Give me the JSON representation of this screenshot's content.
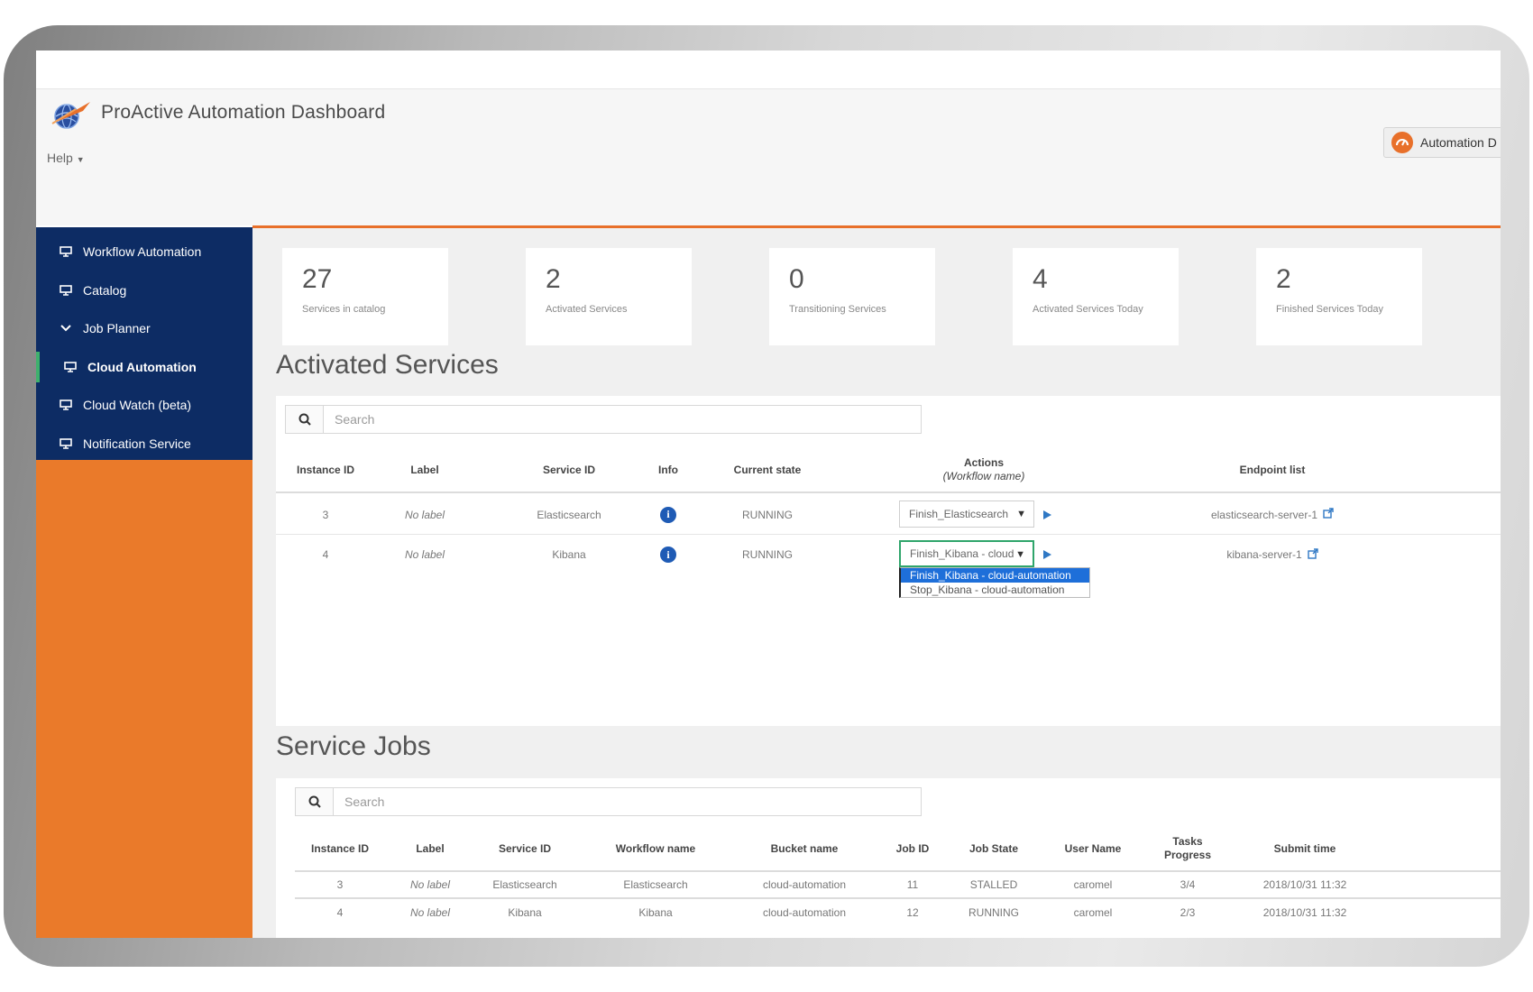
{
  "header": {
    "title": "ProActive Automation Dashboard",
    "help_label": "Help",
    "portal_button_label": "Automation D"
  },
  "sidebar": {
    "items": [
      {
        "label": "Workflow Automation",
        "icon": "monitor-icon"
      },
      {
        "label": "Catalog",
        "icon": "monitor-icon"
      },
      {
        "label": "Job Planner",
        "icon": "chevron-down-icon"
      },
      {
        "label": "Cloud Automation",
        "icon": "monitor-icon",
        "active": true
      },
      {
        "label": "Cloud Watch (beta)",
        "icon": "monitor-icon"
      },
      {
        "label": "Notification Service",
        "icon": "monitor-icon"
      }
    ]
  },
  "stats": [
    {
      "value": "27",
      "label": "Services in catalog"
    },
    {
      "value": "2",
      "label": "Activated Services"
    },
    {
      "value": "0",
      "label": "Transitioning Services"
    },
    {
      "value": "4",
      "label": "Activated Services Today"
    },
    {
      "value": "2",
      "label": "Finished Services Today"
    }
  ],
  "activated_services": {
    "title": "Activated Services",
    "search_placeholder": "Search",
    "columns": {
      "instance_id": "Instance ID",
      "label": "Label",
      "service_id": "Service ID",
      "info": "Info",
      "current_state": "Current state",
      "actions": "Actions",
      "actions_sub": "(Workflow name)",
      "endpoint": "Endpoint list"
    },
    "rows": [
      {
        "instance_id": "3",
        "label": "No label",
        "service_id": "Elasticsearch",
        "state": "RUNNING",
        "action": "Finish_Elasticsearch",
        "endpoint": "elasticsearch-server-1"
      },
      {
        "instance_id": "4",
        "label": "No label",
        "service_id": "Kibana",
        "state": "RUNNING",
        "action": "Finish_Kibana - cloud",
        "endpoint": "kibana-server-1"
      }
    ],
    "dropdown_options": [
      "Finish_Kibana - cloud-automation",
      "Stop_Kibana - cloud-automation"
    ]
  },
  "service_jobs": {
    "title": "Service Jobs",
    "search_placeholder": "Search",
    "columns": {
      "instance_id": "Instance ID",
      "label": "Label",
      "service_id": "Service ID",
      "workflow_name": "Workflow name",
      "bucket_name": "Bucket name",
      "job_id": "Job ID",
      "job_state": "Job State",
      "user_name": "User Name",
      "tasks_progress": "Tasks Progress",
      "submit_time": "Submit time"
    },
    "rows": [
      {
        "instance_id": "3",
        "label": "No label",
        "service_id": "Elasticsearch",
        "workflow_name": "Elasticsearch",
        "bucket_name": "cloud-automation",
        "job_id": "11",
        "job_state": "STALLED",
        "user_name": "caromel",
        "tasks_progress": "3/4",
        "submit_time": "2018/10/31 11:32"
      },
      {
        "instance_id": "4",
        "label": "No label",
        "service_id": "Kibana",
        "workflow_name": "Kibana",
        "bucket_name": "cloud-automation",
        "job_id": "12",
        "job_state": "RUNNING",
        "user_name": "caromel",
        "tasks_progress": "2/3",
        "submit_time": "2018/10/31 11:32"
      }
    ]
  },
  "colors": {
    "accent_orange": "#e8702a",
    "nav_blue": "#0d2c64",
    "active_marker": "#3fb16d",
    "link_blue": "#2f78c4"
  }
}
